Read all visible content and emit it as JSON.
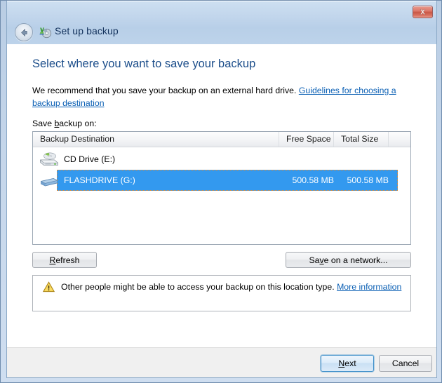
{
  "window": {
    "title": "Set up backup",
    "title_icon": "backup-disk-icon",
    "close_label": "x",
    "back_label": "back-arrow"
  },
  "content": {
    "heading": "Select where you want to save your backup",
    "recommend_text": "We recommend that you save your backup on an external hard drive. ",
    "recommend_link": "Guidelines for choosing a backup destination",
    "save_label_pre": "Save ",
    "save_label_accel": "b",
    "save_label_post": "ackup on:"
  },
  "listview": {
    "columns": [
      "Backup Destination",
      "Free Space",
      "Total Size"
    ],
    "rows": [
      {
        "icon": "cd-drive-icon",
        "name": "CD Drive (E:)",
        "free_space": "",
        "total_size": "",
        "selected": false
      },
      {
        "icon": "flash-drive-icon",
        "name": "FLASHDRIVE (G:)",
        "free_space": "500.58 MB",
        "total_size": "500.58 MB",
        "selected": true
      }
    ]
  },
  "buttons": {
    "refresh_pre": "",
    "refresh_accel": "R",
    "refresh_post": "efresh",
    "network_pre": "Sa",
    "network_accel": "v",
    "network_post": "e on a network...",
    "next_accel": "N",
    "next_post": "ext",
    "cancel": "Cancel"
  },
  "warning": {
    "icon": "warning-triangle-icon",
    "text": "Other people might be able to access your backup on this location type. ",
    "link": "More information"
  },
  "colors": {
    "heading": "#1b4d8a",
    "link": "#0a5fb4",
    "selection": "#3399ef",
    "titlebar_top": "#cddff1",
    "frame": "#c5d6ea",
    "footer": "#f0f0f0",
    "close_button": "#c85645",
    "warning": "#f0c020"
  }
}
